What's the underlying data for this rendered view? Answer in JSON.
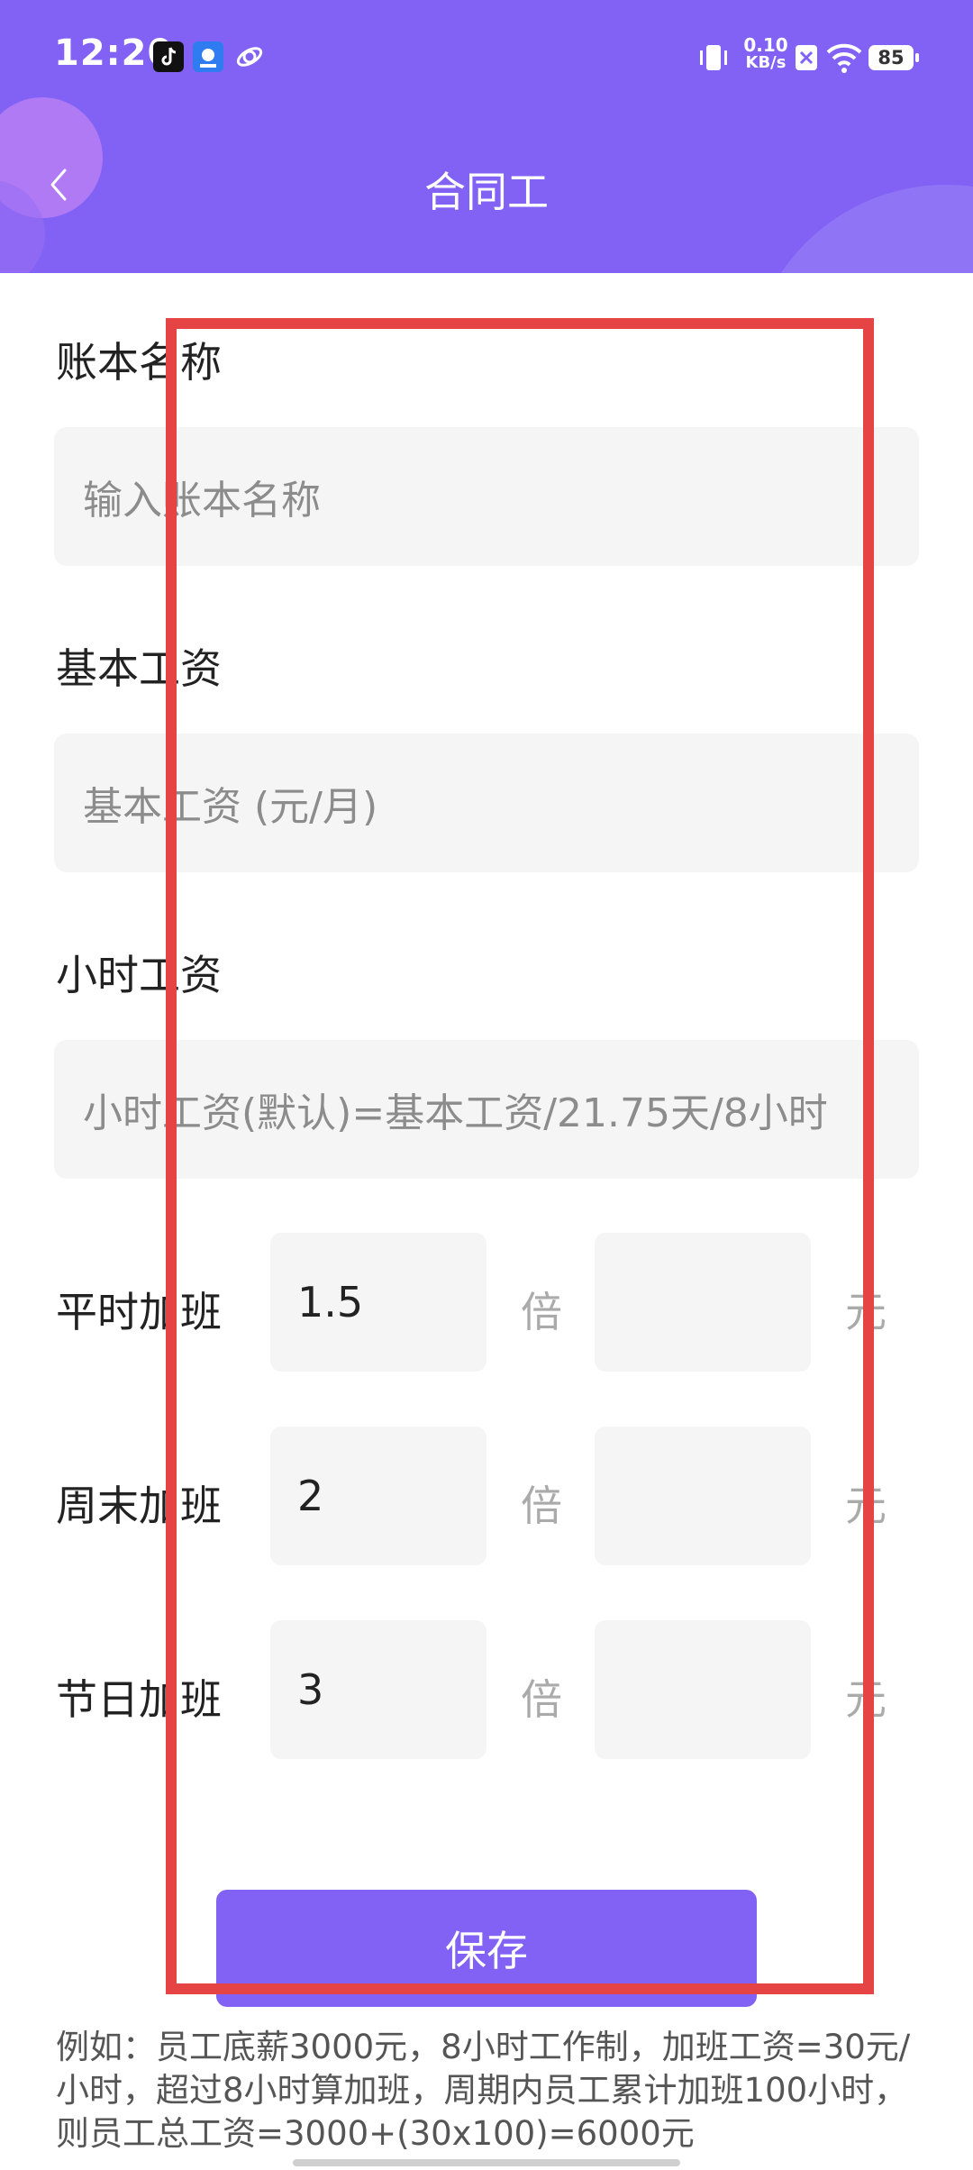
{
  "status_bar": {
    "time": "12:20",
    "net_speed_value": "0.10",
    "net_speed_unit": "KB/s",
    "battery": "85"
  },
  "header": {
    "title": "合同工"
  },
  "form": {
    "ledger_name": {
      "label": "账本名称",
      "placeholder": "输入账本名称"
    },
    "base_salary": {
      "label": "基本工资",
      "placeholder": "基本工资 (元/月)"
    },
    "hourly_wage": {
      "label": "小时工资",
      "placeholder": "小时工资(默认)=基本工资/21.75天/8小时"
    },
    "overtime": [
      {
        "label": "平时加班",
        "multiplier": "1.5",
        "times_unit": "倍",
        "amount": "",
        "money_unit": "元"
      },
      {
        "label": "周末加班",
        "multiplier": "2",
        "times_unit": "倍",
        "amount": "",
        "money_unit": "元"
      },
      {
        "label": "节日加班",
        "multiplier": "3",
        "times_unit": "倍",
        "amount": "",
        "money_unit": "元"
      }
    ]
  },
  "save_label": "保存",
  "example_note": "例如：员工底薪3000元，8小时工作制，加班工资=30元/小时，超过8小时算加班，周期内员工累计加班100小时，则员工总工资=3000+(30x100)=6000元",
  "colors": {
    "accent": "#8162F4",
    "highlight": "#E64444"
  }
}
